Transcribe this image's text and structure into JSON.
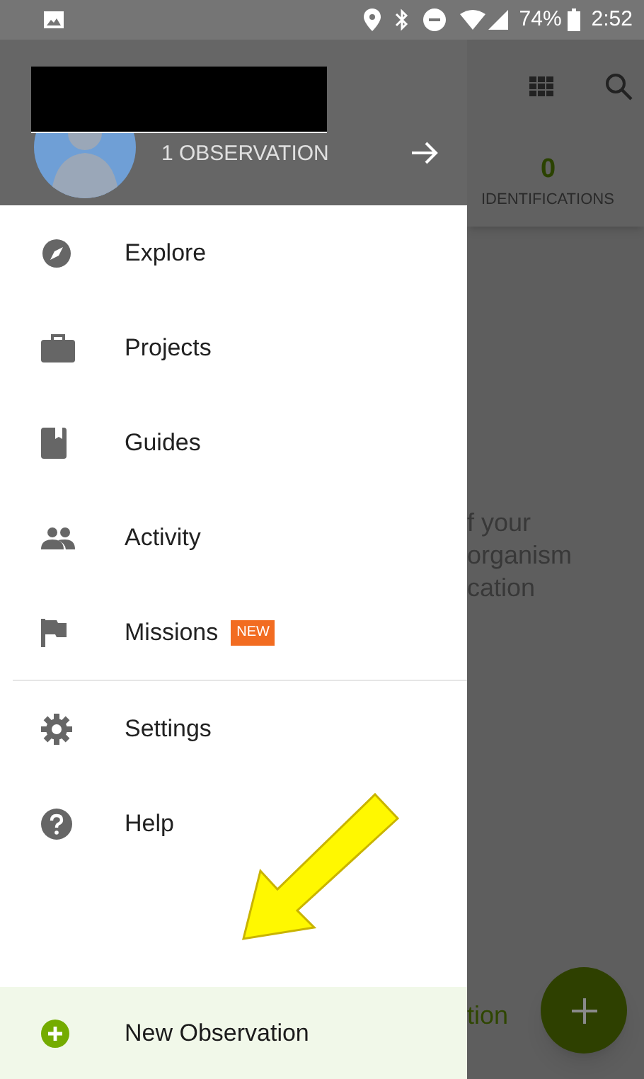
{
  "status_bar": {
    "battery": "74%",
    "time": "2:52"
  },
  "drawer": {
    "header": {
      "observations": "1 OBSERVATION"
    },
    "items": [
      {
        "label": "Explore",
        "selected": false
      },
      {
        "label": "Projects",
        "selected": false
      },
      {
        "label": "Guides",
        "selected": false
      },
      {
        "label": "Activity",
        "selected": false
      },
      {
        "label": "Missions",
        "selected": false,
        "badge": "NEW"
      }
    ],
    "secondary_items": [
      {
        "label": "Settings",
        "selected": false
      },
      {
        "label": "Help",
        "selected": false
      }
    ],
    "footer_item": {
      "label": "New Observation",
      "selected": true
    }
  },
  "background": {
    "identifications_count": "0",
    "identifications_label": "IDENTIFICATIONS",
    "message_lines": [
      "f your",
      "organism",
      "cation"
    ],
    "action_fragment": "tion"
  }
}
